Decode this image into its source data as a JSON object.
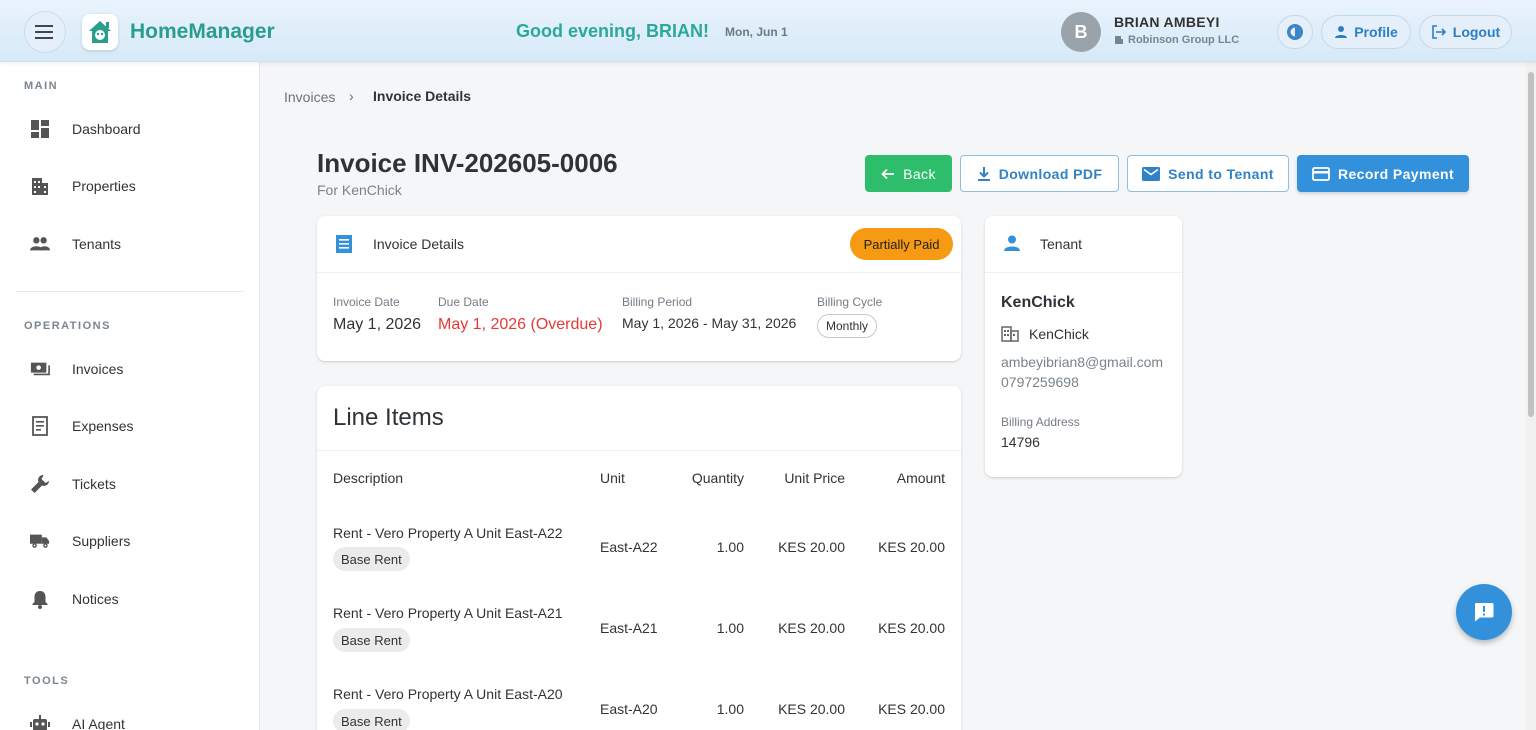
{
  "header": {
    "brand": "HomeManager",
    "greeting": "Good evening, BRIAN!",
    "date": "Mon, Jun 1",
    "avatar_letter": "B",
    "user_name": "BRIAN AMBEYI",
    "company": "Robinson Group LLC",
    "profile_label": "Profile",
    "logout_label": "Logout"
  },
  "sidebar": {
    "sections": {
      "main": "MAIN",
      "operations": "OPERATIONS",
      "tools": "TOOLS"
    },
    "items": {
      "dashboard": "Dashboard",
      "properties": "Properties",
      "tenants": "Tenants",
      "invoices": "Invoices",
      "expenses": "Expenses",
      "tickets": "Tickets",
      "suppliers": "Suppliers",
      "notices": "Notices",
      "ai_agent": "AI Agent"
    }
  },
  "breadcrumb": {
    "parent": "Invoices",
    "separator": "›",
    "current": "Invoice Details"
  },
  "invoice": {
    "title": "Invoice INV-202605-0006",
    "subtitle": "For KenChick"
  },
  "actions": {
    "back": "Back",
    "download_pdf": "Download PDF",
    "send_to_tenant": "Send to Tenant",
    "record_payment": "Record Payment"
  },
  "details": {
    "title": "Invoice Details",
    "status": "Partially Paid",
    "status_color": "#f59a12",
    "invoice_date_label": "Invoice Date",
    "invoice_date": "May 1, 2026",
    "due_date_label": "Due Date",
    "due_date": "May 1, 2026 (Overdue)",
    "billing_period_label": "Billing Period",
    "billing_period": "May 1, 2026 - May 31, 2026",
    "billing_cycle_label": "Billing Cycle",
    "billing_cycle": "Monthly"
  },
  "tenant": {
    "title": "Tenant",
    "name": "KenChick",
    "company": "KenChick",
    "email": "ambeyibrian8@gmail.com",
    "phone": "0797259698",
    "billing_address_label": "Billing Address",
    "billing_address": "14796"
  },
  "line_items": {
    "title": "Line Items",
    "columns": {
      "description": "Description",
      "unit": "Unit",
      "quantity": "Quantity",
      "unit_price": "Unit Price",
      "amount": "Amount"
    },
    "rows": [
      {
        "description": "Rent - Vero Property A Unit East-A22",
        "tag": "Base Rent",
        "unit": "East-A22",
        "quantity": "1.00",
        "unit_price": "KES 20.00",
        "amount": "KES 20.00"
      },
      {
        "description": "Rent - Vero Property A Unit East-A21",
        "tag": "Base Rent",
        "unit": "East-A21",
        "quantity": "1.00",
        "unit_price": "KES 20.00",
        "amount": "KES 20.00"
      },
      {
        "description": "Rent - Vero Property A Unit East-A20",
        "tag": "Base Rent",
        "unit": "East-A20",
        "quantity": "1.00",
        "unit_price": "KES 20.00",
        "amount": "KES 20.00"
      }
    ]
  },
  "colors": {
    "accent": "#3391db",
    "brand": "#2a9d8f",
    "success": "#2ebd6b",
    "overdue": "#e53935"
  }
}
